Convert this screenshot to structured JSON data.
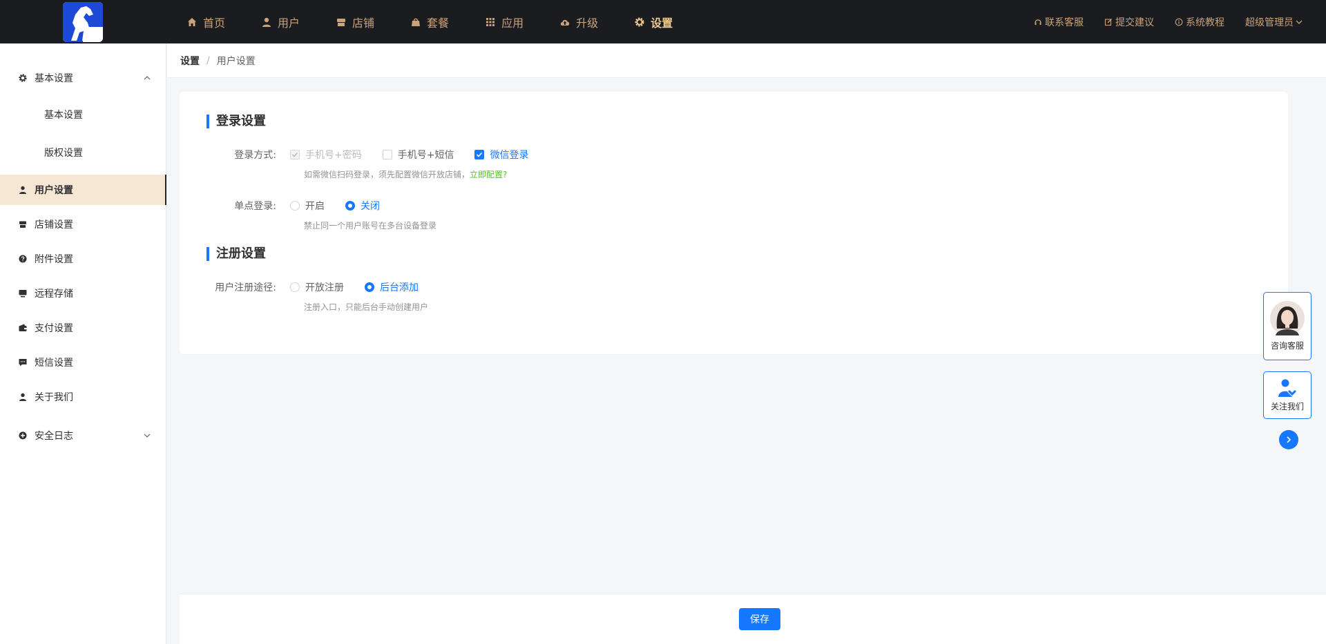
{
  "topbar": {
    "nav": [
      {
        "label": "首页",
        "icon": "home-icon"
      },
      {
        "label": "用户",
        "icon": "user-icon"
      },
      {
        "label": "店铺",
        "icon": "store-icon"
      },
      {
        "label": "套餐",
        "icon": "bag-icon"
      },
      {
        "label": "应用",
        "icon": "grid-icon"
      },
      {
        "label": "升级",
        "icon": "cloud-upload-icon"
      },
      {
        "label": "设置",
        "icon": "gear-icon",
        "active": true
      }
    ],
    "right": [
      {
        "label": "联系客服",
        "icon": "headset-icon"
      },
      {
        "label": "提交建议",
        "icon": "edit-icon"
      },
      {
        "label": "系统教程",
        "icon": "info-circle-icon"
      },
      {
        "label": "超级管理员",
        "icon": "chevron-down-icon"
      }
    ]
  },
  "sidebar": {
    "items": [
      {
        "label": "基本设置",
        "icon": "gear-icon",
        "expanded": true
      },
      {
        "label": "基本设置",
        "sub": true
      },
      {
        "label": "版权设置",
        "sub": true
      },
      {
        "label": "用户设置",
        "icon": "user-icon",
        "active": true
      },
      {
        "label": "店铺设置",
        "icon": "store-icon"
      },
      {
        "label": "附件设置",
        "icon": "question-circle-icon"
      },
      {
        "label": "远程存储",
        "icon": "monitor-icon"
      },
      {
        "label": "支付设置",
        "icon": "wallet-icon"
      },
      {
        "label": "短信设置",
        "icon": "message-icon"
      },
      {
        "label": "关于我们",
        "icon": "user-icon"
      },
      {
        "label": "安全日志",
        "icon": "plus-circle-icon",
        "expanded": false
      }
    ]
  },
  "breadcrumb": {
    "root": "设置",
    "sep": "/",
    "current": "用户设置"
  },
  "login_section": {
    "title": "登录设置",
    "method_label": "登录方式:",
    "methods": [
      {
        "label": "手机号+密码",
        "checked": true,
        "disabled": true
      },
      {
        "label": "手机号+短信",
        "checked": false
      },
      {
        "label": "微信登录",
        "checked": true
      }
    ],
    "method_hint": "如需微信扫码登录，须先配置微信开放店铺，",
    "method_hint_link": "立即配置?",
    "sso_label": "单点登录:",
    "sso_options": [
      {
        "label": "开启",
        "checked": false
      },
      {
        "label": "关闭",
        "checked": true
      }
    ],
    "sso_hint": "禁止同一个用户账号在多台设备登录"
  },
  "register_section": {
    "title": "注册设置",
    "path_label": "用户注册途径:",
    "path_options": [
      {
        "label": "开放注册",
        "checked": false
      },
      {
        "label": "后台添加",
        "checked": true
      }
    ],
    "path_hint": "注册入口，只能后台手动创建用户"
  },
  "float": {
    "consult": "咨询客服",
    "follow": "关注我们"
  },
  "footer": {
    "save_label": "保存"
  },
  "colors": {
    "accent": "#1677ff",
    "topbar": "#1b1c20",
    "nav_text": "#c9a37a",
    "sidebar_active": "#f6e7d4"
  }
}
